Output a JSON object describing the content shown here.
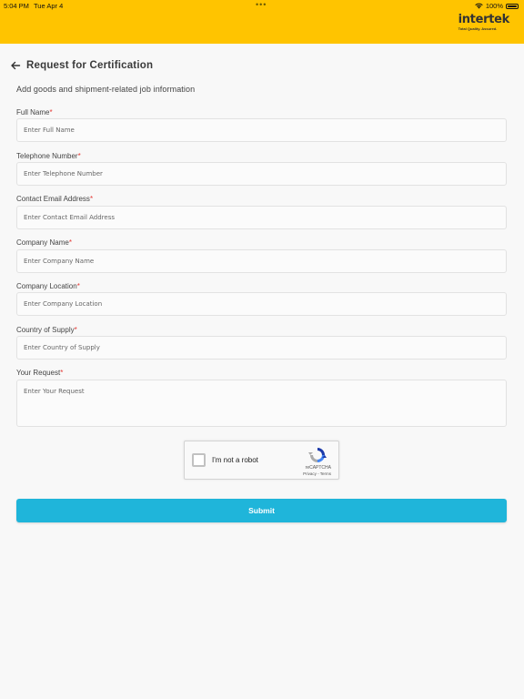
{
  "status_bar": {
    "time": "5:04 PM",
    "date": "Tue Apr 4",
    "dots": "•••",
    "battery": "100%"
  },
  "header": {
    "logo_text": "intertek",
    "logo_tagline": "Total Quality. Assured."
  },
  "page": {
    "title": "Request for Certification",
    "subtitle": "Add goods and shipment-related job information"
  },
  "form": {
    "required_marker": "*",
    "fields": [
      {
        "label": "Full Name",
        "placeholder": "Enter Full Name"
      },
      {
        "label": "Telephone Number",
        "placeholder": "Enter Telephone Number"
      },
      {
        "label": "Contact Email Address",
        "placeholder": "Enter Contact Email Address"
      },
      {
        "label": "Company Name",
        "placeholder": "Enter Company Name"
      },
      {
        "label": "Company Location",
        "placeholder": "Enter Company Location"
      },
      {
        "label": "Country of Supply",
        "placeholder": "Enter Country of Supply"
      },
      {
        "label": "Your Request",
        "placeholder": "Enter Your Request"
      }
    ],
    "submit_label": "Submit"
  },
  "recaptcha": {
    "label": "I'm not a robot",
    "brand": "reCAPTCHA",
    "terms": "Privacy - Terms"
  },
  "colors": {
    "header": "#ffc400",
    "submit": "#1fb5da",
    "required": "#e53935"
  }
}
